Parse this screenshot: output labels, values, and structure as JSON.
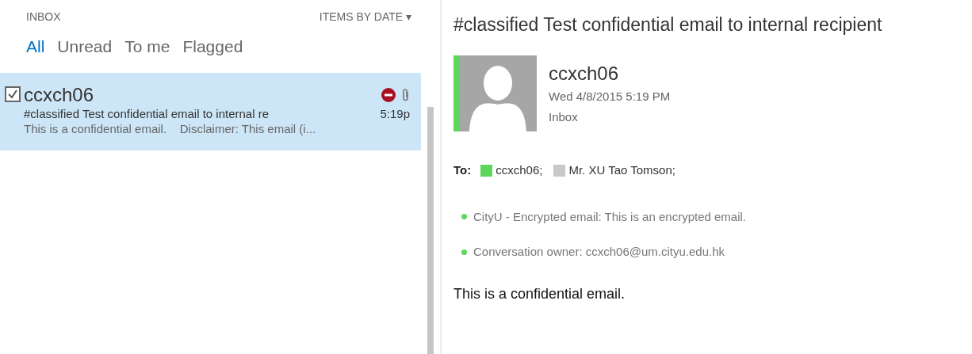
{
  "message_list": {
    "folder": "INBOX",
    "sort": "ITEMS BY DATE ▾",
    "filters": [
      {
        "label": "All",
        "selected": true
      },
      {
        "label": "Unread",
        "selected": false
      },
      {
        "label": "To me",
        "selected": false
      },
      {
        "label": "Flagged",
        "selected": false
      }
    ],
    "items": [
      {
        "sender": "ccxch06",
        "subject": "#classified Test confidential email to internal re",
        "preview": "This is a confidential email.    Disclaimer: This email (i...",
        "time": "5:19p",
        "selected": true,
        "checked": true,
        "restricted": true,
        "attachment": true
      }
    ]
  },
  "reading_pane": {
    "subject": "#classified Test confidential email to internal recipient",
    "sender": "ccxch06",
    "date": "Wed 4/8/2015 5:19 PM",
    "folder": "Inbox",
    "to_label": "To:",
    "recipients": [
      {
        "name": "ccxch06;",
        "color": "#5cd65c"
      },
      {
        "name": "Mr. XU Tao Tomson;",
        "color": "#c8c8c8"
      }
    ],
    "infobar": [
      "CityU - Encrypted email: This is an encrypted email.",
      "Conversation owner: ccxch06@um.cityu.edu.hk"
    ],
    "body": "This is a confidential email."
  }
}
